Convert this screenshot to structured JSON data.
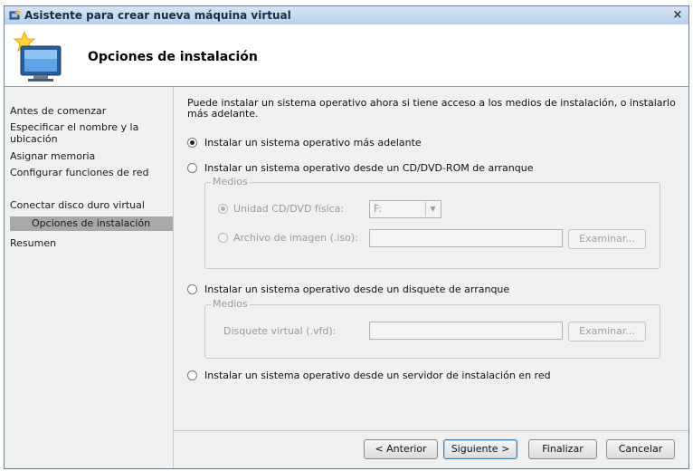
{
  "window": {
    "title": "Asistente para crear nueva máquina virtual",
    "close_label": "×"
  },
  "header": {
    "page_title": "Opciones de instalación",
    "icon": "wizard-computer-star-icon"
  },
  "sidebar": {
    "items": [
      {
        "label": "Antes de comenzar"
      },
      {
        "label": "Especificar el nombre y la ubicación"
      },
      {
        "label": "Asignar memoria"
      },
      {
        "label": "Configurar funciones de red"
      },
      {
        "label": "Conectar disco duro virtual"
      },
      {
        "label": "Opciones de instalación",
        "active": true
      },
      {
        "label": "Resumen"
      }
    ]
  },
  "main": {
    "intro": "Puede instalar un sistema operativo ahora si tiene acceso a los medios de instalación, o instalarlo más adelante.",
    "options": [
      {
        "label": "Instalar un sistema operativo más adelante",
        "checked": true
      },
      {
        "label": "Instalar un sistema operativo desde un CD/DVD-ROM de arranque",
        "checked": false
      },
      {
        "label": "Instalar un sistema operativo desde un disquete de arranque",
        "checked": false
      },
      {
        "label": "Instalar un sistema operativo desde un servidor de instalación en red",
        "checked": false
      }
    ],
    "cd_group": {
      "legend": "Medios",
      "physical_label": "Unidad CD/DVD física:",
      "physical_value": "F:",
      "image_label": "Archivo de imagen (.iso):",
      "image_value": "",
      "browse": "Examinar..."
    },
    "floppy_group": {
      "legend": "Medios",
      "label": "Disquete virtual (.vfd):",
      "value": "",
      "browse": "Examinar..."
    }
  },
  "footer": {
    "back": "< Anterior",
    "next": "Siguiente >",
    "finish": "Finalizar",
    "cancel": "Cancelar"
  },
  "colors": {
    "title_bar": "#c6d8ef",
    "active_step": "#a8a8a8",
    "dialog_bg": "#f0f0f0"
  }
}
